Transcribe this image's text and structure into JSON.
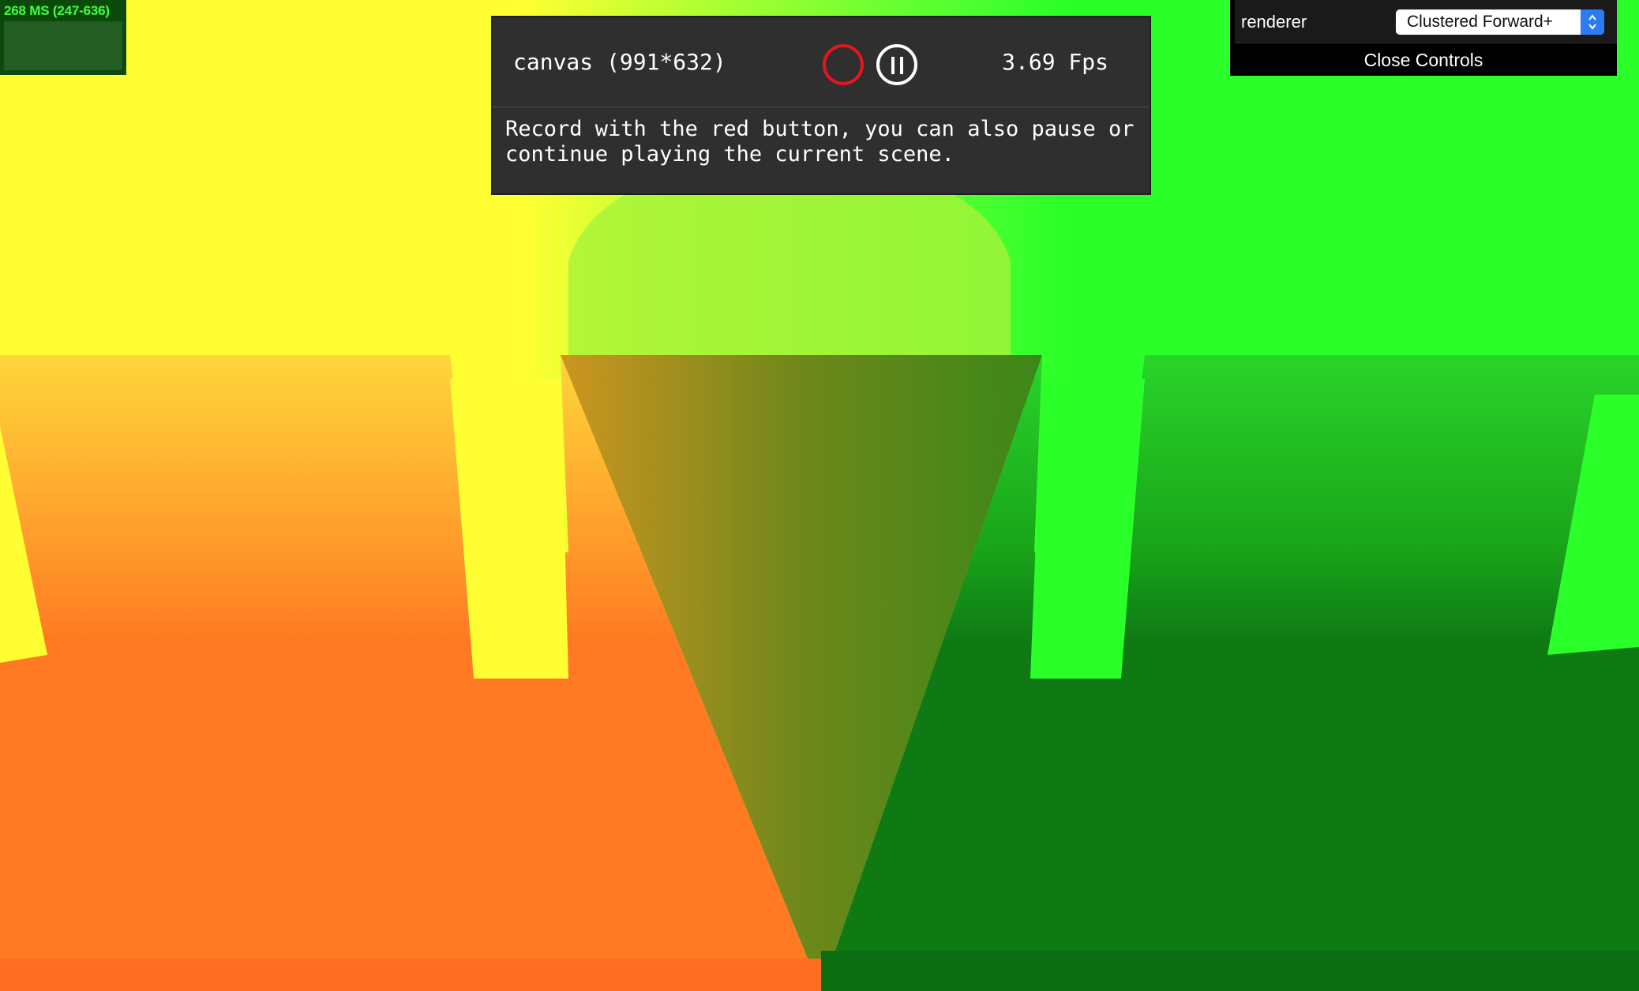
{
  "stats": {
    "label": "268 MS (247-636)"
  },
  "recorder": {
    "canvas_label": "canvas (991*632)",
    "fps": "3.69 Fps",
    "description": "Record with the red button, you can also pause or\ncontinue playing the current scene.",
    "record_icon": "record-icon",
    "pause_icon": "pause-icon"
  },
  "controls": {
    "renderer_label": "renderer",
    "renderer_value": "Clustered Forward+",
    "close_label": "Close Controls"
  },
  "colors": {
    "record": "#e5151c",
    "select_accent": "#2c7bf2",
    "stats_text": "#3dff3d"
  }
}
